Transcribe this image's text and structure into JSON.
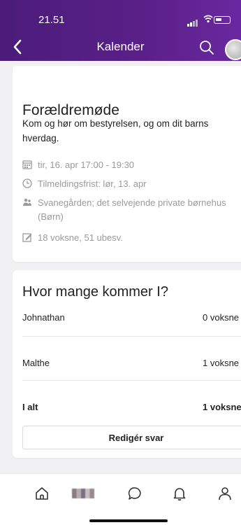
{
  "status_bar": {
    "time": "21.51"
  },
  "header": {
    "title": "Kalender"
  },
  "event": {
    "title": "Forældremøde",
    "description": "Kom og hør om bestyrelsen, og om dit barns hverdag.",
    "date": "tir, 16. apr 17:00 - 19:30",
    "deadline": "Tilmeldingsfrist: lør, 13. apr",
    "location": "Svanegården; det selvejende private børnehus (Børn)",
    "responses": "18 voksne, 51 ubesv."
  },
  "attendance": {
    "title": "Hvor mange kommer I?",
    "rows": [
      {
        "name": "Johnathan",
        "value": "0 voksne"
      },
      {
        "name": "Malthe",
        "value": "1 voksne"
      }
    ],
    "total": {
      "name": "I alt",
      "value": "1 voksne"
    },
    "edit_label": "Redigér svar"
  },
  "tabbar": {
    "items": [
      "home-icon",
      "blurred-image",
      "chat-icon",
      "bell-icon",
      "profile-icon"
    ]
  },
  "colors": {
    "header": "#5a2088",
    "background": "#f1f1f4",
    "muted": "#9a9a9a"
  }
}
